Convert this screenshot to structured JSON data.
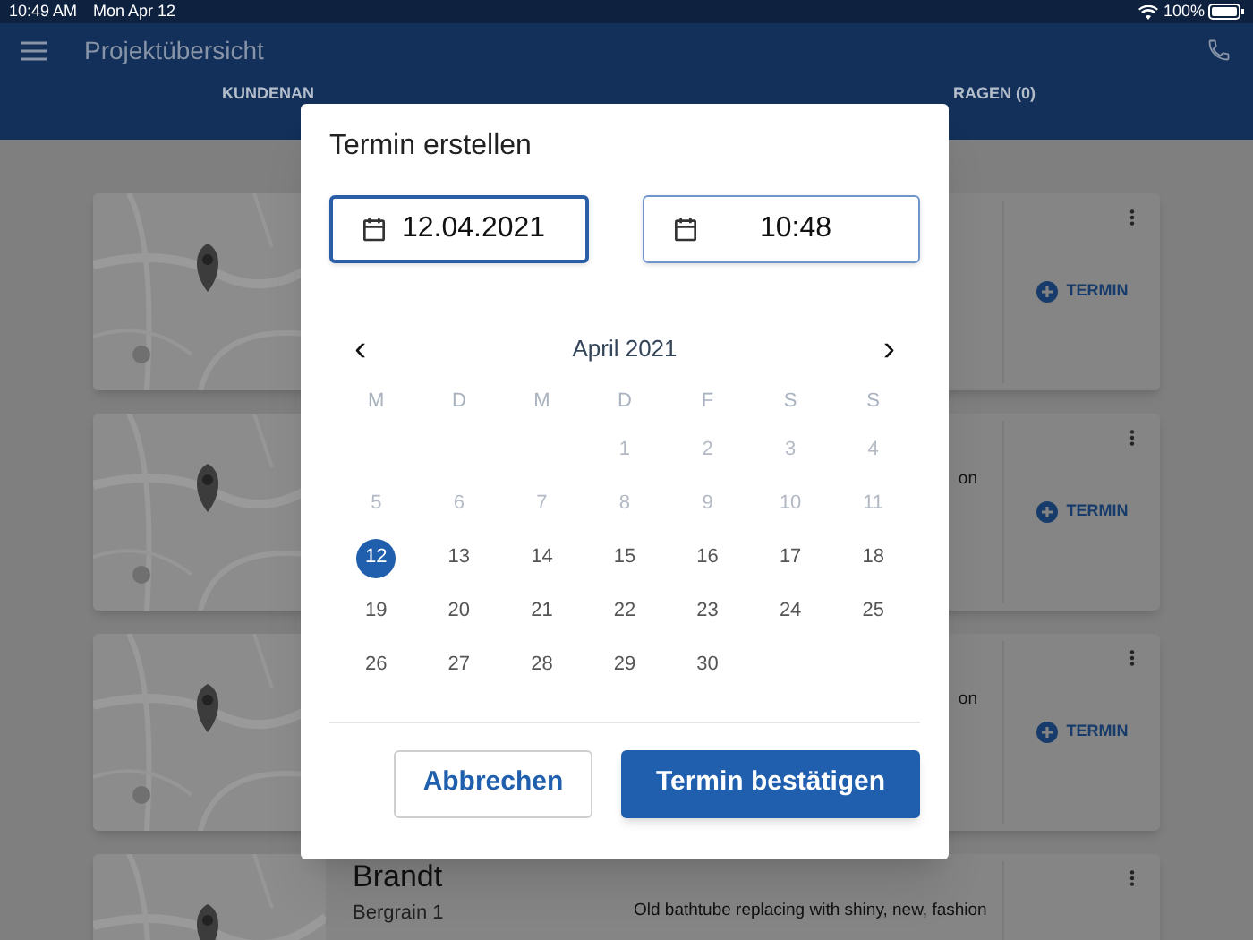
{
  "status_bar": {
    "time": "10:49 AM",
    "date": "Mon Apr 12",
    "battery": "100%"
  },
  "app_bar": {
    "title": "Projektübersicht"
  },
  "tabs": [
    {
      "label": "KUNDENAN"
    },
    {
      "label": "RAGEN (0)"
    }
  ],
  "cards": [
    {
      "map": {
        "kind": "picture"
      },
      "action": "TERMIN"
    },
    {
      "map": {
        "kind": "picture"
      },
      "description": "on",
      "action": "TERMIN"
    },
    {
      "map": {
        "kind": "picture"
      },
      "description": "on",
      "action": "TERMIN"
    },
    {
      "map": {
        "kind": "picture"
      },
      "name": "Brandt",
      "address": [
        "Bergrain 1"
      ],
      "description": "Old bathtube replacing with shiny, new, fashion"
    }
  ],
  "dialog": {
    "title": "Termin erstellen",
    "date": {
      "value": "12.04.2021",
      "focused": true
    },
    "time": {
      "value": "10:48",
      "focused": false
    },
    "calendar": {
      "month": "April 2021",
      "prev": "‹",
      "next": "›",
      "weekdays": [
        "M",
        "D",
        "M",
        "D",
        "F",
        "S",
        "S"
      ],
      "weeks": [
        [
          {
            "kind": "blank"
          },
          {
            "kind": "blank"
          },
          {
            "kind": "blank"
          },
          {
            "kind": "day",
            "label": "1",
            "disabled": true,
            "selected": false
          },
          {
            "kind": "day",
            "label": "2",
            "disabled": true,
            "selected": false
          },
          {
            "kind": "day",
            "label": "3",
            "disabled": true,
            "selected": false
          },
          {
            "kind": "day",
            "label": "4",
            "disabled": true,
            "selected": false
          }
        ],
        [
          {
            "kind": "day",
            "label": "5",
            "disabled": true,
            "selected": false
          },
          {
            "kind": "day",
            "label": "6",
            "disabled": true,
            "selected": false
          },
          {
            "kind": "day",
            "label": "7",
            "disabled": true,
            "selected": false
          },
          {
            "kind": "day",
            "label": "8",
            "disabled": true,
            "selected": false
          },
          {
            "kind": "day",
            "label": "9",
            "disabled": true,
            "selected": false
          },
          {
            "kind": "day",
            "label": "10",
            "disabled": true,
            "selected": false
          },
          {
            "kind": "day",
            "label": "11",
            "disabled": true,
            "selected": false
          }
        ],
        [
          {
            "kind": "day",
            "label": "12",
            "disabled": false,
            "selected": true
          },
          {
            "kind": "day",
            "label": "13",
            "disabled": false,
            "selected": false
          },
          {
            "kind": "day",
            "label": "14",
            "disabled": false,
            "selected": false
          },
          {
            "kind": "day",
            "label": "15",
            "disabled": false,
            "selected": false
          },
          {
            "kind": "day",
            "label": "16",
            "disabled": false,
            "selected": false
          },
          {
            "kind": "day",
            "label": "17",
            "disabled": false,
            "selected": false
          },
          {
            "kind": "day",
            "label": "18",
            "disabled": false,
            "selected": false
          }
        ],
        [
          {
            "kind": "day",
            "label": "19",
            "disabled": false,
            "selected": false
          },
          {
            "kind": "day",
            "label": "20",
            "disabled": false,
            "selected": false
          },
          {
            "kind": "day",
            "label": "21",
            "disabled": false,
            "selected": false
          },
          {
            "kind": "day",
            "label": "22",
            "disabled": false,
            "selected": false
          },
          {
            "kind": "day",
            "label": "23",
            "disabled": false,
            "selected": false
          },
          {
            "kind": "day",
            "label": "24",
            "disabled": false,
            "selected": false
          },
          {
            "kind": "day",
            "label": "25",
            "disabled": false,
            "selected": false
          }
        ],
        [
          {
            "kind": "day",
            "label": "26",
            "disabled": false,
            "selected": false
          },
          {
            "kind": "day",
            "label": "27",
            "disabled": false,
            "selected": false
          },
          {
            "kind": "day",
            "label": "28",
            "disabled": false,
            "selected": false
          },
          {
            "kind": "day",
            "label": "29",
            "disabled": false,
            "selected": false
          },
          {
            "kind": "day",
            "label": "30",
            "disabled": false,
            "selected": false
          },
          {
            "kind": "blank"
          },
          {
            "kind": "blank"
          }
        ]
      ]
    },
    "buttons": [
      {
        "kind": "outline",
        "label": "Abbrechen"
      },
      {
        "kind": "primary",
        "label": "Termin bestätigen"
      }
    ]
  }
}
